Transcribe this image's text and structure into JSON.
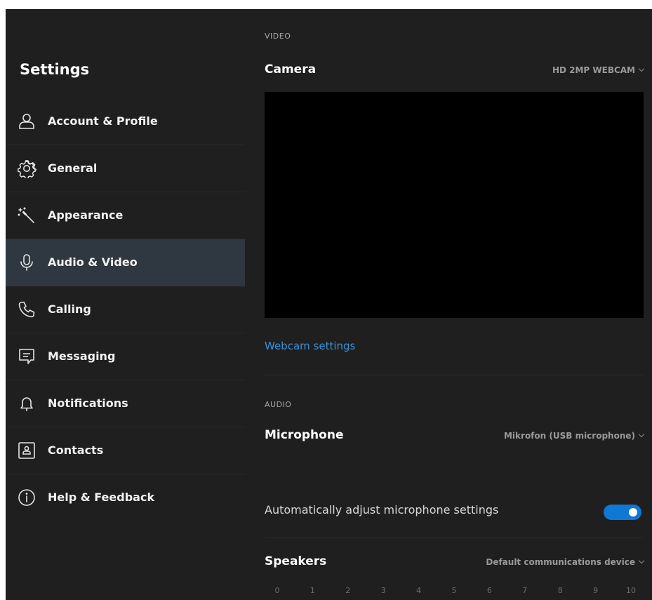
{
  "sidebar": {
    "title": "Settings",
    "items": [
      {
        "label": "Account & Profile",
        "icon": "person-icon"
      },
      {
        "label": "General",
        "icon": "gear-icon"
      },
      {
        "label": "Appearance",
        "icon": "magic-wand-icon"
      },
      {
        "label": "Audio & Video",
        "icon": "microphone-icon",
        "active": true
      },
      {
        "label": "Calling",
        "icon": "phone-icon"
      },
      {
        "label": "Messaging",
        "icon": "message-icon"
      },
      {
        "label": "Notifications",
        "icon": "bell-icon"
      },
      {
        "label": "Contacts",
        "icon": "contact-card-icon"
      },
      {
        "label": "Help & Feedback",
        "icon": "info-icon"
      }
    ]
  },
  "video": {
    "section_label": "VIDEO",
    "camera_label": "Camera",
    "camera_device": "HD 2MP WEBCAM",
    "webcam_settings_link": "Webcam settings"
  },
  "audio": {
    "section_label": "AUDIO",
    "microphone_label": "Microphone",
    "microphone_device": "Mikrofon (USB microphone)",
    "auto_adjust_label": "Automatically adjust microphone settings",
    "auto_adjust_on": true,
    "speakers_label": "Speakers",
    "speakers_device": "Default communications device",
    "volume_scale": [
      "0",
      "1",
      "2",
      "3",
      "4",
      "5",
      "6",
      "7",
      "8",
      "9",
      "10"
    ]
  },
  "colors": {
    "background": "#1f1f1f",
    "active_item": "#2f3840",
    "accent": "#0f78d4",
    "link": "#3c8fd8"
  }
}
